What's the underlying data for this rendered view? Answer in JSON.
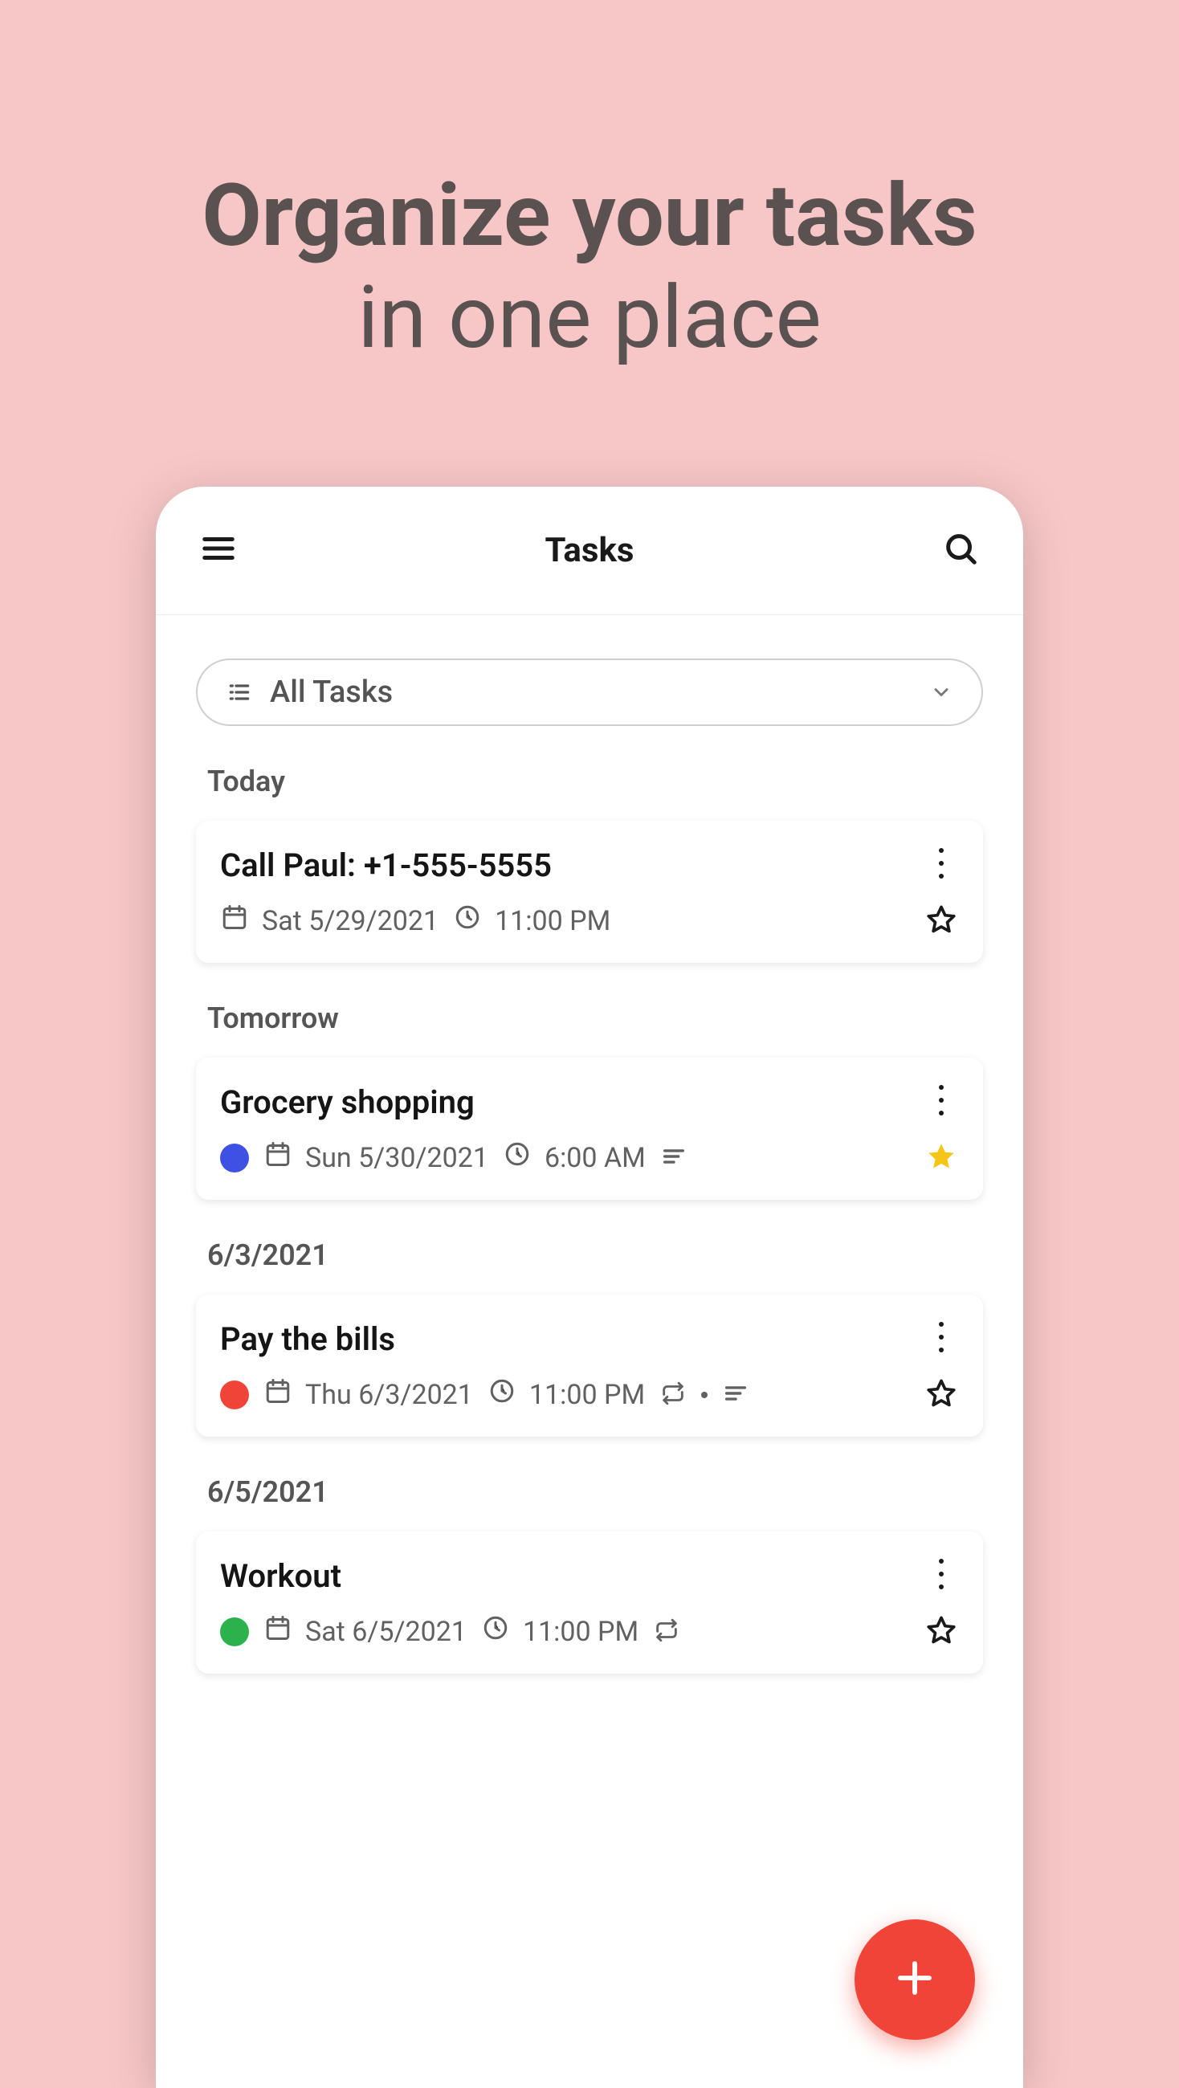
{
  "promo": {
    "line1": "Organize your tasks",
    "line2": "in one place"
  },
  "appbar": {
    "title": "Tasks"
  },
  "filter": {
    "label": "All Tasks"
  },
  "colors": {
    "accent": "#f04438",
    "star_active": "#f5c518",
    "cat_blue": "#3f51e3",
    "cat_orange": "#f04438",
    "cat_green": "#2bb24c"
  },
  "sections": [
    {
      "header": "Today",
      "tasks": [
        {
          "title": "Call Paul: +1-555-5555",
          "date": "Sat 5/29/2021",
          "time": "11:00 PM",
          "categoryColor": null,
          "starred": false,
          "hasNotes": false,
          "repeats": false
        }
      ]
    },
    {
      "header": "Tomorrow",
      "tasks": [
        {
          "title": "Grocery shopping",
          "date": "Sun 5/30/2021",
          "time": "6:00 AM",
          "categoryColor": "#3f51e3",
          "starred": true,
          "hasNotes": true,
          "repeats": false
        }
      ]
    },
    {
      "header": "6/3/2021",
      "tasks": [
        {
          "title": "Pay the bills",
          "date": "Thu 6/3/2021",
          "time": "11:00 PM",
          "categoryColor": "#f04438",
          "starred": false,
          "hasNotes": true,
          "repeats": true
        }
      ]
    },
    {
      "header": "6/5/2021",
      "tasks": [
        {
          "title": "Workout",
          "date": "Sat 6/5/2021",
          "time": "11:00 PM",
          "categoryColor": "#2bb24c",
          "starred": false,
          "hasNotes": false,
          "repeats": true
        }
      ]
    }
  ]
}
